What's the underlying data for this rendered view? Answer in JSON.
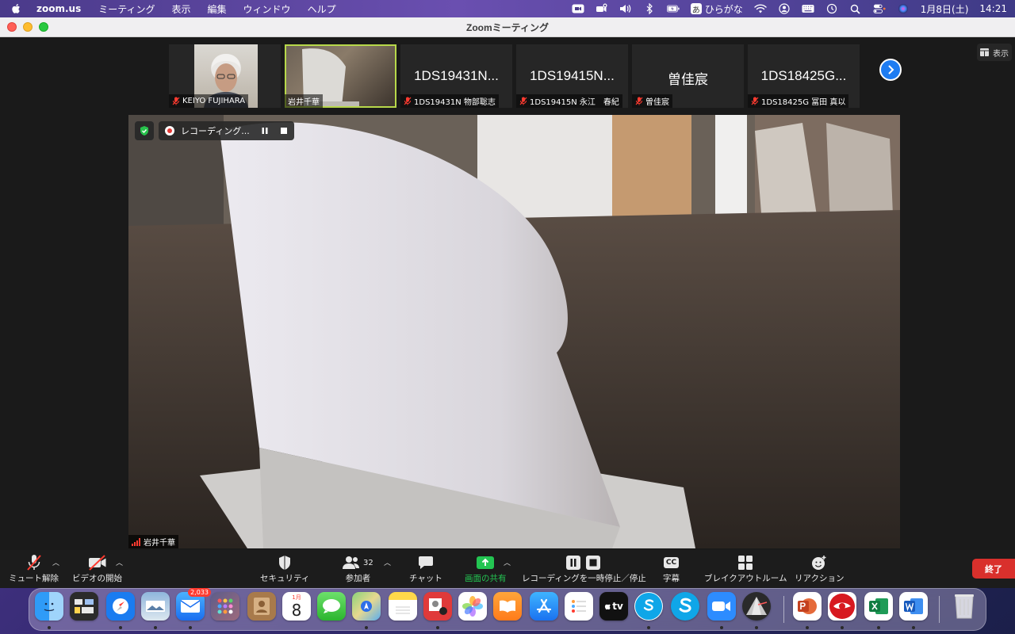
{
  "menubar": {
    "app_name": "zoom.us",
    "menus": [
      "ミーティング",
      "表示",
      "編集",
      "ウィンドウ",
      "ヘルプ"
    ],
    "ime_label": "あ",
    "ime_mode": "ひらがな",
    "date": "1月8日(土)",
    "time": "14:21"
  },
  "window": {
    "title": "Zoomミーティング",
    "view_button_label": "表示"
  },
  "participants": [
    {
      "big_name": "",
      "tag_name": "KEIYO FUJIHARA",
      "muted": true,
      "has_video": true,
      "kind": "face"
    },
    {
      "big_name": "",
      "tag_name": "岩井千華",
      "muted": false,
      "has_video": true,
      "kind": "object",
      "active": true
    },
    {
      "big_name": "1DS19431N...",
      "tag_name": "1DS19431N 物部聡志",
      "muted": true,
      "has_video": false
    },
    {
      "big_name": "1DS19415N...",
      "tag_name": "1DS19415N 永江　春紀",
      "muted": true,
      "has_video": false
    },
    {
      "big_name": "曽佳宸",
      "tag_name": "曽佳宸",
      "muted": true,
      "has_video": false
    },
    {
      "big_name": "1DS18425G...",
      "tag_name": "1DS18425G 冨田 真以",
      "muted": true,
      "has_video": false
    }
  ],
  "main_video": {
    "recording_label": "レコーディング...",
    "speaker_name": "岩井千華"
  },
  "toolbar": {
    "unmute_label": "ミュート解除",
    "start_video_label": "ビデオの開始",
    "security_label": "セキュリティ",
    "participants_label": "参加者",
    "participants_count": "32",
    "chat_label": "チャット",
    "share_label": "画面の共有",
    "recording_label": "レコーディングを一時停止／停止",
    "captions_label": "字幕",
    "captions_icon_text": "CC",
    "breakout_label": "ブレイクアウトルーム",
    "reactions_label": "リアクション",
    "end_label": "終了"
  },
  "dock": {
    "mail_badge": "2,033",
    "calendar_month": "1月",
    "calendar_day": "8",
    "tv_label": "tv"
  },
  "colors": {
    "share_green": "#23c552",
    "end_red": "#d9302c",
    "active_outline": "#b7d84a",
    "next_blue": "#1d7cf2"
  }
}
